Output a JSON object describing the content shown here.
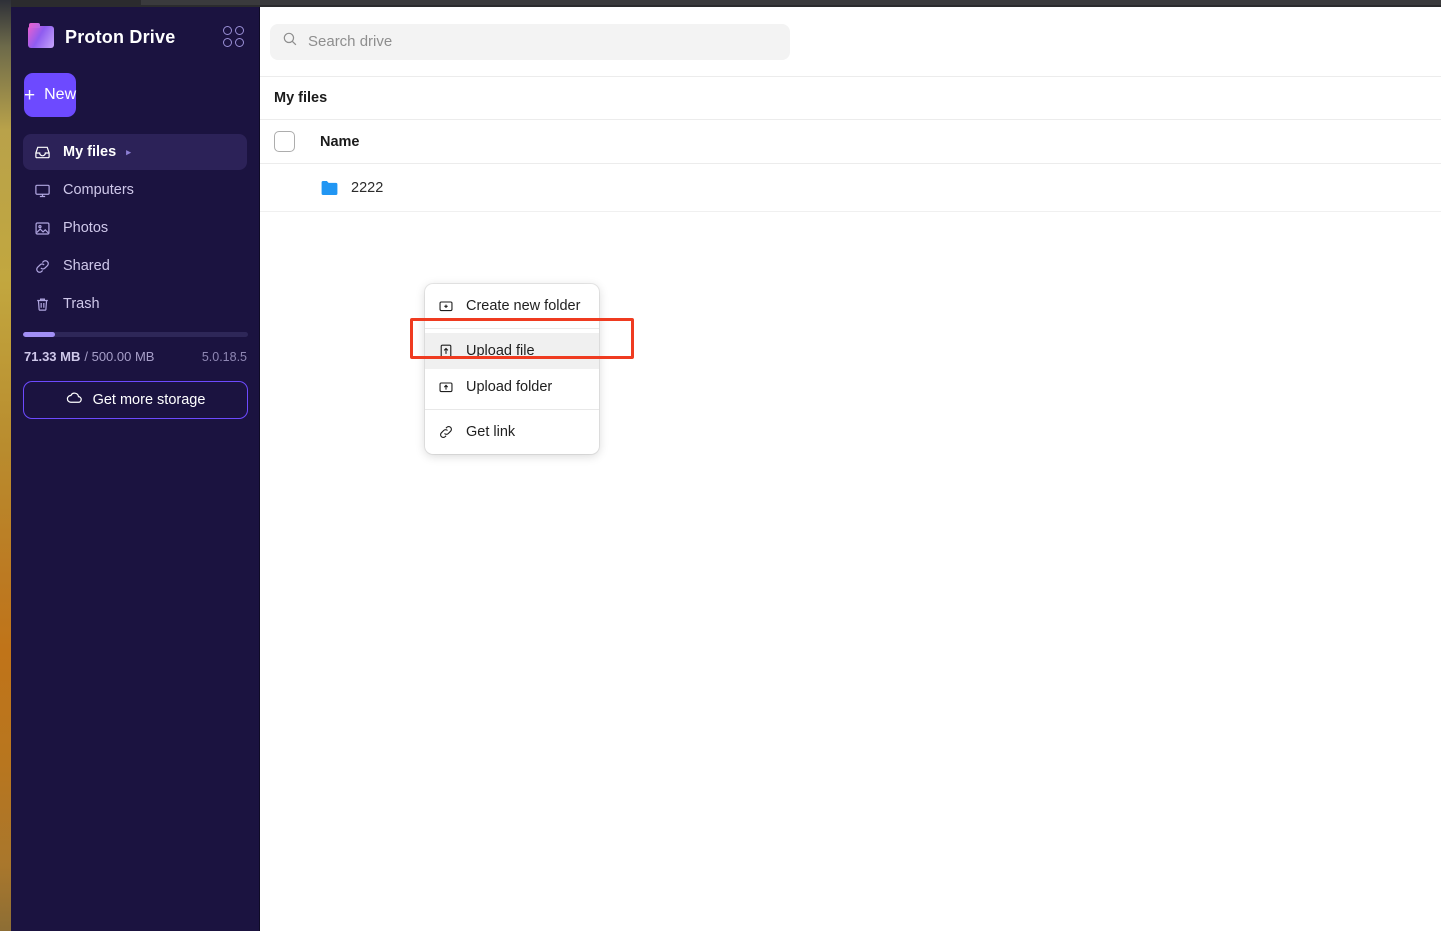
{
  "sidebar": {
    "brand": {
      "name": "Proton Drive",
      "logo_icon": "proton-drive-folder-logo",
      "apps_icon": "app-grid-icon"
    },
    "new_button": {
      "label": "New",
      "icon": "plus-icon"
    },
    "items": [
      {
        "label": "My files",
        "icon": "inbox-icon",
        "active": true,
        "caret": "▸"
      },
      {
        "label": "Computers",
        "icon": "monitor-icon",
        "active": false
      },
      {
        "label": "Photos",
        "icon": "image-icon",
        "active": false
      },
      {
        "label": "Shared",
        "icon": "link-icon",
        "active": false
      },
      {
        "label": "Trash",
        "icon": "trash-icon",
        "active": false
      }
    ],
    "storage": {
      "used": "71.33 MB",
      "total": "/ 500.00 MB",
      "version": "5.0.18.5",
      "percent": 14,
      "button_label": "Get more storage",
      "button_icon": "cloud-icon"
    }
  },
  "main": {
    "search": {
      "placeholder": "Search drive",
      "value": "",
      "icon": "search-icon"
    },
    "breadcrumb": "My files",
    "table": {
      "columns": [
        "Name"
      ],
      "rows": [
        {
          "name": "2222",
          "icon": "folder-icon"
        }
      ]
    }
  },
  "context_menu": {
    "items": [
      {
        "label": "Create new folder",
        "icon": "folder-plus-icon",
        "highlighted": false
      },
      {
        "label": "Upload file",
        "icon": "file-upload-icon",
        "highlighted": true
      },
      {
        "label": "Upload folder",
        "icon": "folder-upload-icon",
        "highlighted": false
      },
      {
        "label": "Get link",
        "icon": "link-icon",
        "highlighted": false
      }
    ]
  },
  "colors": {
    "accent": "#6d4aff",
    "sidebar_bg": "#1b1340",
    "active_item_bg": "#2c2258",
    "highlight_box": "#ef3b20",
    "folder_blue": "#2196f3"
  }
}
